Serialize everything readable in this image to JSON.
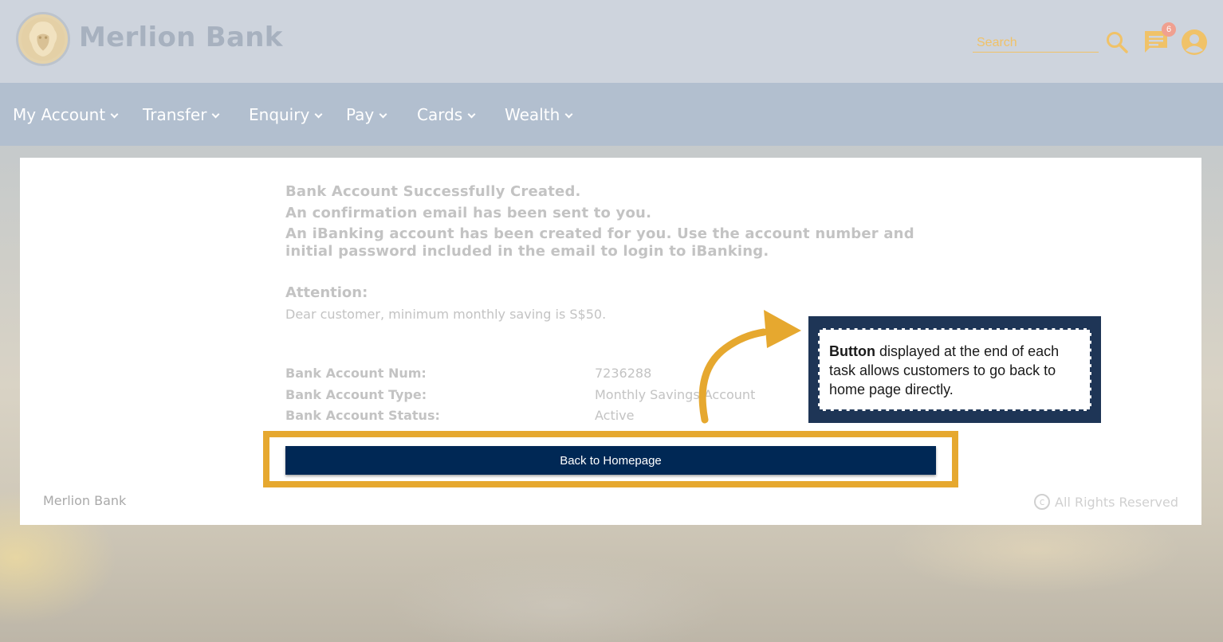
{
  "header": {
    "brand": "Merlion Bank",
    "search_placeholder": "Search",
    "notification_count": "6",
    "icons": [
      "lion-logo-icon",
      "search-icon",
      "chat-icon",
      "user-icon"
    ]
  },
  "nav": {
    "items": [
      {
        "label": "My Account"
      },
      {
        "label": "Transfer"
      },
      {
        "label": "Enquiry"
      },
      {
        "label": "Pay"
      },
      {
        "label": "Cards"
      },
      {
        "label": "Wealth"
      }
    ]
  },
  "main": {
    "messages": [
      "Bank Account Successfully Created.",
      "An confirmation email has been sent to you.",
      "An iBanking account has been created for you. Use the account number and initial password included in the email to login to iBanking."
    ],
    "attention_title": "Attention:",
    "attention_text": "Dear customer, minimum monthly saving is S$50.",
    "details": [
      {
        "label": "Bank Account Num:",
        "value": "7236288"
      },
      {
        "label": "Bank Account Type:",
        "value": "Monthly Savings Account"
      },
      {
        "label": "Bank Account Status:",
        "value": "Active"
      }
    ],
    "button_label": "Back to Homepage"
  },
  "footer": {
    "left": "Merlion Bank",
    "right": "All Rights Reserved",
    "copyright_symbol": "c"
  },
  "callout": {
    "bold": "Button",
    "text": " displayed at the end of each task allows customers to go back to home page directly."
  },
  "colors": {
    "accent": "#e6a82f",
    "button": "#002855",
    "callout_bg": "#1e3556",
    "nav_bg": "#b2bfcf"
  }
}
